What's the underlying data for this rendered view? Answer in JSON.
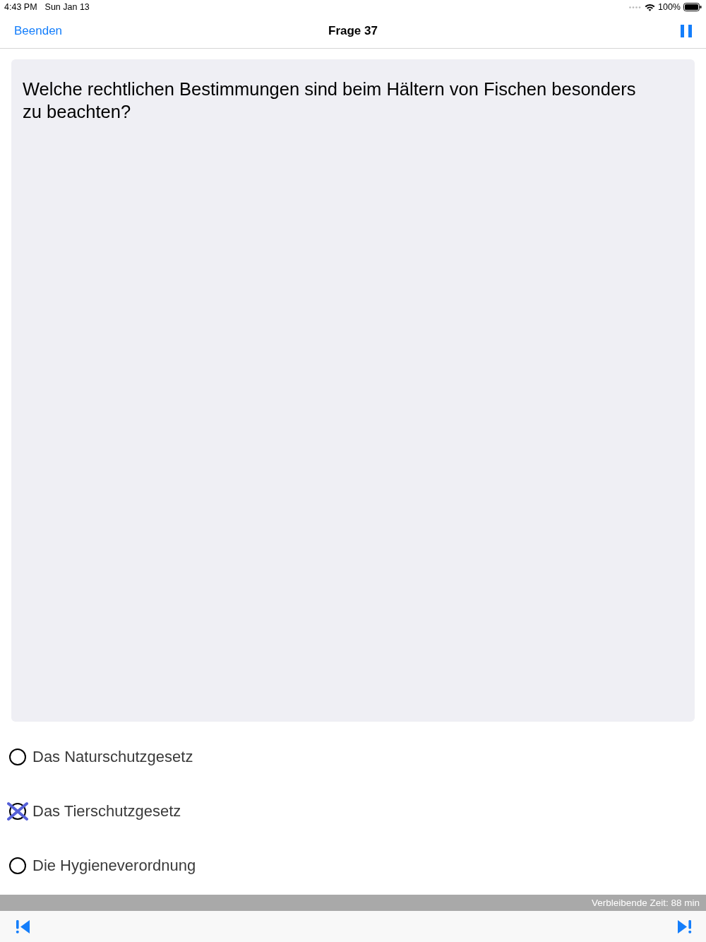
{
  "status_bar": {
    "time": "4:43 PM",
    "date": "Sun Jan 13",
    "battery": "100%"
  },
  "nav_bar": {
    "left_button": "Beenden",
    "title": "Frage 37"
  },
  "question": {
    "text": "Welche rechtlichen Bestimmungen sind beim Hältern von Fischen besonders zu beachten?"
  },
  "options": [
    {
      "label": "Das Naturschutzgesetz",
      "selected": false
    },
    {
      "label": "Das Tierschutzgesetz",
      "selected": true
    },
    {
      "label": "Die Hygieneverordnung",
      "selected": false
    }
  ],
  "timer": {
    "text": "Verbleibende Zeit: 88 min"
  }
}
